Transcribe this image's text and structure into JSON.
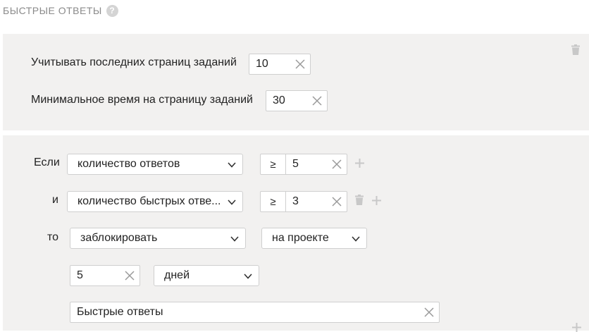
{
  "header": {
    "title": "БЫСТРЫЕ ОТВЕТЫ",
    "help_glyph": "?"
  },
  "settings": {
    "last_pages_label": "Учитывать последних страниц заданий",
    "last_pages_value": "10",
    "min_time_label": "Минимальное время на страницу заданий",
    "min_time_value": "30"
  },
  "rule": {
    "if_label": "Если",
    "and_label": "и",
    "then_label": "то",
    "conditions": [
      {
        "metric": "количество ответов",
        "operator": "≥",
        "value": "5"
      },
      {
        "metric": "количество быстрых отве...",
        "operator": "≥",
        "value": "3"
      }
    ],
    "action": "заблокировать",
    "scope": "на проекте",
    "duration_value": "5",
    "duration_unit": "дней",
    "comment": "Быстрые ответы"
  },
  "colors": {
    "panel_bg": "#f2f1f0",
    "border": "#cfcfcf",
    "icon": "#c8c8c8",
    "header_text": "#8a8a8a"
  }
}
